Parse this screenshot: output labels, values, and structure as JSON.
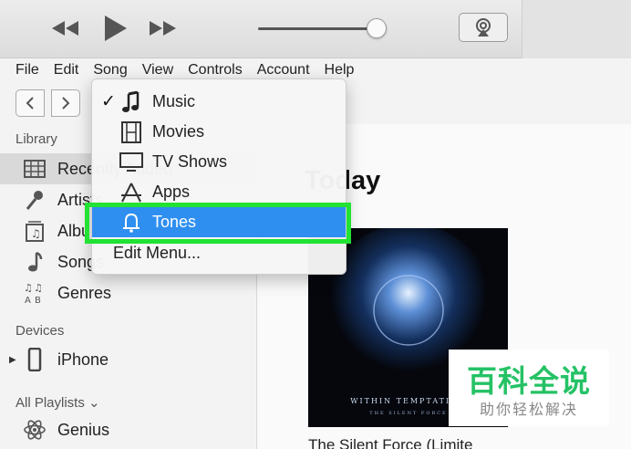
{
  "menubar": {
    "items": [
      "File",
      "Edit",
      "Song",
      "View",
      "Controls",
      "Account",
      "Help"
    ]
  },
  "dropdown": {
    "items": [
      {
        "label": "Music",
        "icon": "music-note-icon",
        "checked": true
      },
      {
        "label": "Movies",
        "icon": "film-icon",
        "checked": false
      },
      {
        "label": "TV Shows",
        "icon": "tv-icon",
        "checked": false
      },
      {
        "label": "Apps",
        "icon": "app-store-icon",
        "checked": false
      },
      {
        "label": "Tones",
        "icon": "bell-icon",
        "checked": false,
        "active": true
      }
    ],
    "check_glyph": "✓",
    "edit_label": "Edit Menu..."
  },
  "sidebar": {
    "library_header": "Library",
    "library_items": [
      {
        "label": "Recently Added",
        "icon": "grid-icon"
      },
      {
        "label": "Artists",
        "icon": "microphone-icon"
      },
      {
        "label": "Albums",
        "icon": "album-icon"
      },
      {
        "label": "Songs",
        "icon": "music-note-icon"
      },
      {
        "label": "Genres",
        "icon": "genres-icon"
      }
    ],
    "devices_header": "Devices",
    "device": {
      "label": "iPhone",
      "icon": "iphone-icon"
    },
    "playlists_header": "All Playlists ⌄",
    "playlist": {
      "label": "Genius",
      "icon": "genius-atom-icon"
    }
  },
  "main": {
    "heading": "Today",
    "album_art_text": "WITHIN TEMPTATION",
    "album_art_subtext": "THE SILENT FORCE",
    "album_title": "The Silent Force (Limite"
  },
  "watermark": {
    "title": "百科全说",
    "subtitle": "助你轻松解决"
  },
  "colors": {
    "accent": "#2f8ff0",
    "highlight_box": "#22e233",
    "watermark_green": "#25c265"
  }
}
